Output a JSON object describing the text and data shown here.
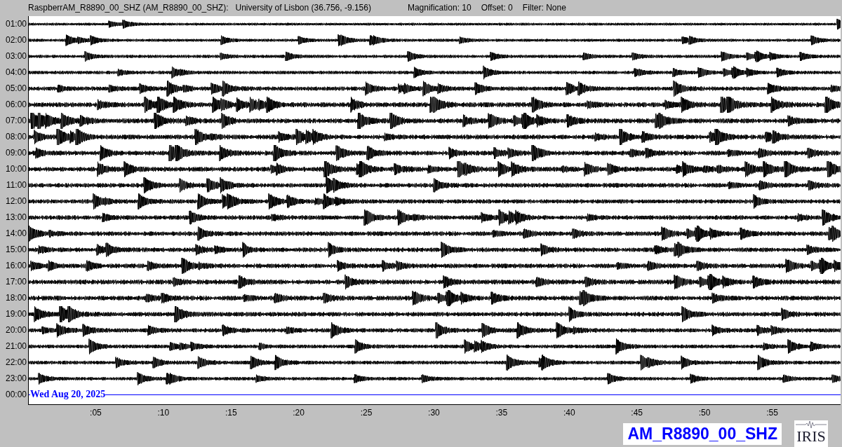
{
  "header": {
    "station": "RaspberrAM_R8890_00_SHZ (AM_R8890_00_SHZ):",
    "location": "University of Lisbon (36.756, -9.156)",
    "magnification": "Magnification: 10",
    "offset": "Offset: 0",
    "filter": "Filter: None"
  },
  "rows": [
    {
      "time": "01:00"
    },
    {
      "time": "02:00"
    },
    {
      "time": "03:00"
    },
    {
      "time": "04:00"
    },
    {
      "time": "05:00"
    },
    {
      "time": "06:00"
    },
    {
      "time": "07:00"
    },
    {
      "time": "08:00"
    },
    {
      "time": "09:00"
    },
    {
      "time": "10:00"
    },
    {
      "time": "11:00"
    },
    {
      "time": "12:00"
    },
    {
      "time": "13:00"
    },
    {
      "time": "14:00"
    },
    {
      "time": "15:00"
    },
    {
      "time": "16:00"
    },
    {
      "time": "17:00"
    },
    {
      "time": "18:00"
    },
    {
      "time": "19:00"
    },
    {
      "time": "20:00"
    },
    {
      "time": "21:00"
    },
    {
      "time": "22:00"
    },
    {
      "time": "23:00"
    },
    {
      "time": "00:00",
      "date": "Wed Aug 20, 2025"
    }
  ],
  "x_ticks": [
    ":05",
    ":10",
    ":15",
    ":20",
    ":25",
    ":30",
    ":35",
    ":40",
    ":45",
    ":50",
    ":55"
  ],
  "channel_label": "AM_R8890_00_SHZ",
  "logo_text": "IRIS"
}
